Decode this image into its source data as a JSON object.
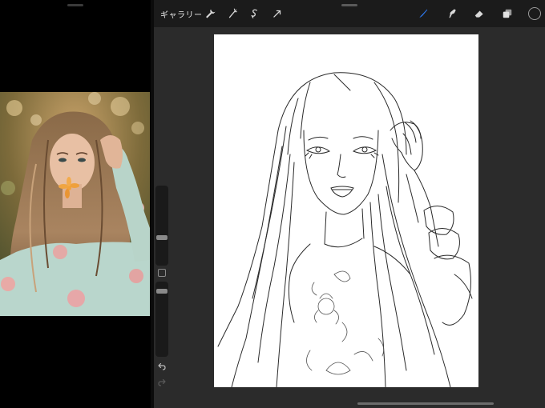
{
  "toolbar": {
    "gallery_label": "ギャラリー",
    "left_tools": [
      "wrench-icon",
      "magic-wand-icon",
      "selection-icon",
      "transform-arrow-icon"
    ],
    "right_tools": [
      "brush-icon",
      "smudge-icon",
      "eraser-icon",
      "layers-icon"
    ],
    "active_tool": "brush-icon",
    "accent_color": "#2f7cf6",
    "current_color": "#1b1b1b"
  },
  "sidebar": {
    "brush_size": 0.34,
    "opacity": 0.9,
    "icons": [
      "undo-icon",
      "redo-icon"
    ]
  },
  "canvas": {
    "background": "#ffffff",
    "content": "line-art-portrait-sketch"
  },
  "reference_photo": {
    "content": "portrait-photo"
  }
}
